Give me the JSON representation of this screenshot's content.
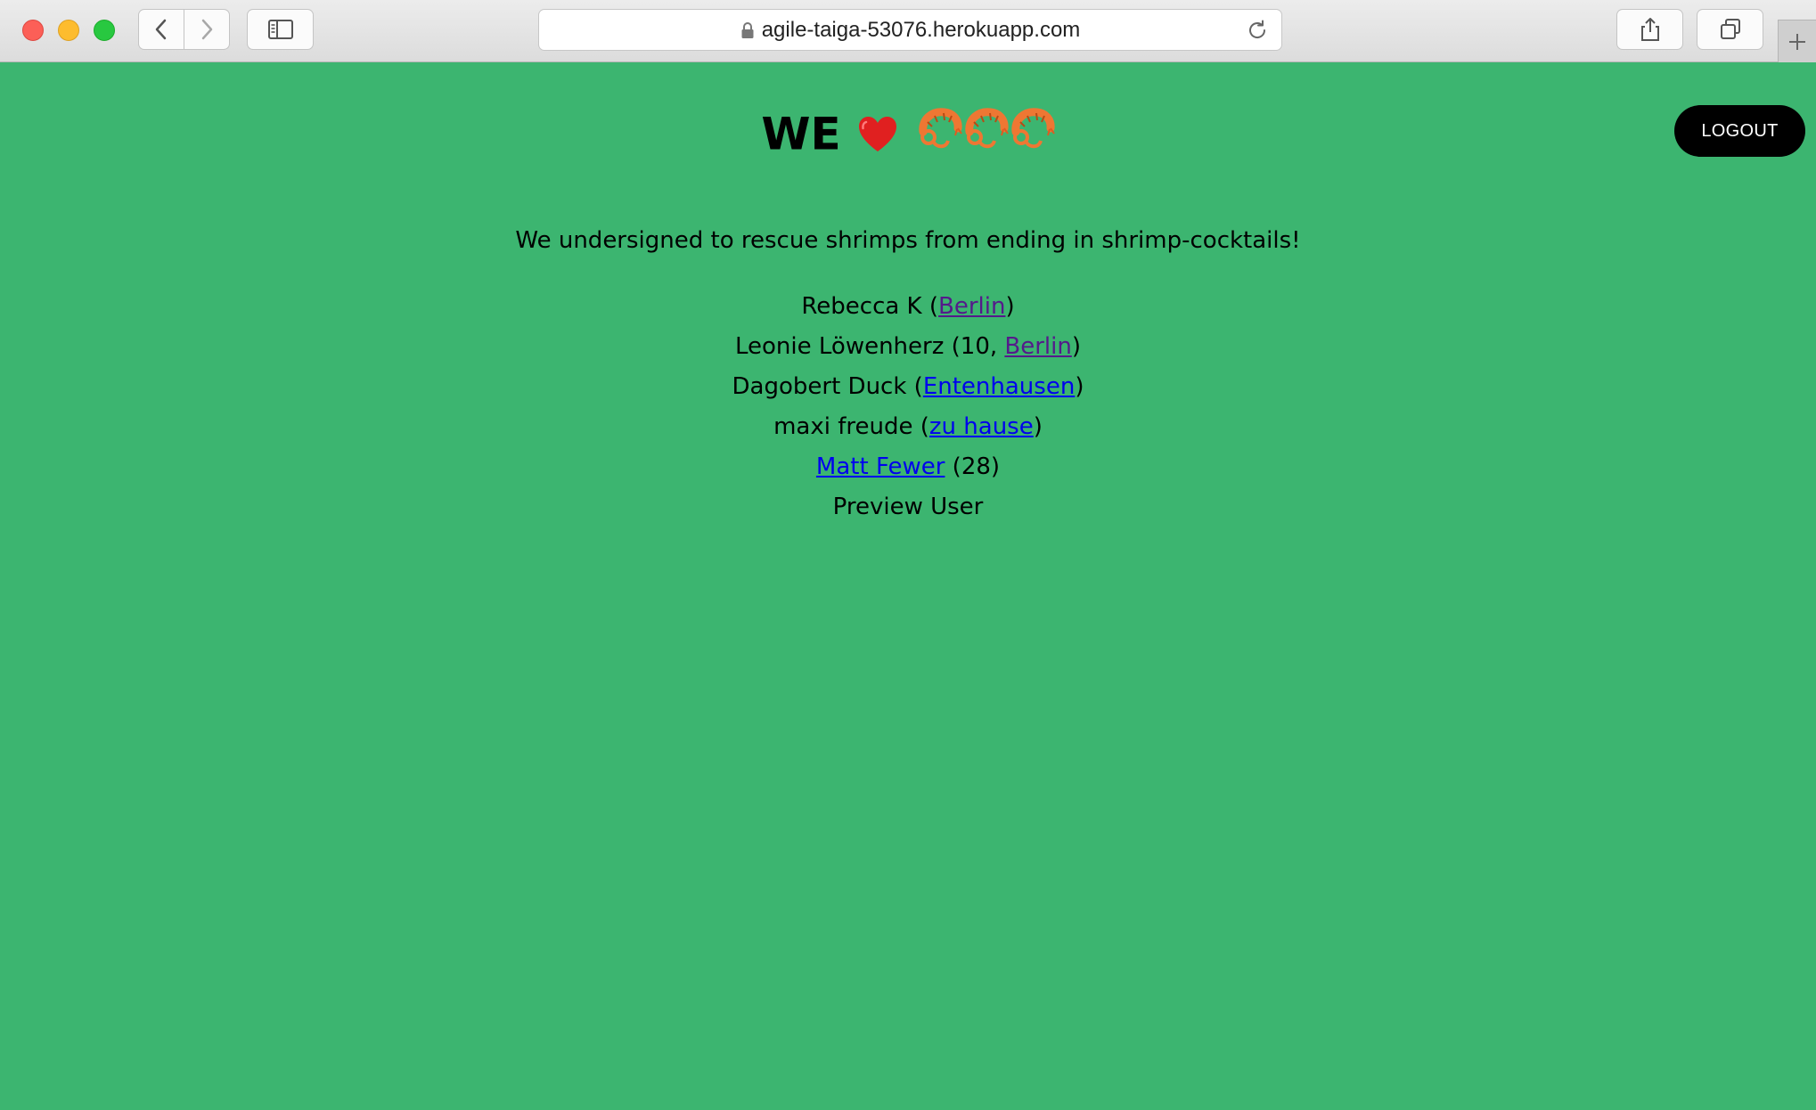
{
  "browser": {
    "url": "agile-taiga-53076.herokuapp.com"
  },
  "header": {
    "title_word": "WE",
    "heart_icon": "red-heart-icon",
    "shrimp_icon": "shrimp-icon",
    "logout_label": "LOGOUT"
  },
  "main": {
    "intro": "We undersigned to rescue shrimps from ending in shrimp-cocktails!",
    "signers": [
      {
        "before": "Rebecca K (",
        "link": "Berlin",
        "after": ")"
      },
      {
        "before": "Leonie Löwenherz (10, ",
        "link": "Berlin",
        "after": ")"
      },
      {
        "before": "Dagobert Duck (",
        "link": "Entenhausen",
        "after": ")"
      },
      {
        "before": "maxi freude (",
        "link": "zu hause",
        "after": ")"
      },
      {
        "before": "",
        "link": "Matt Fewer",
        "after": " (28)"
      },
      {
        "before": "Preview User",
        "link": "",
        "after": ""
      }
    ]
  },
  "colors": {
    "page_background": "#3cb570",
    "link": "#0000ee",
    "visited_link": "#551a8b"
  }
}
